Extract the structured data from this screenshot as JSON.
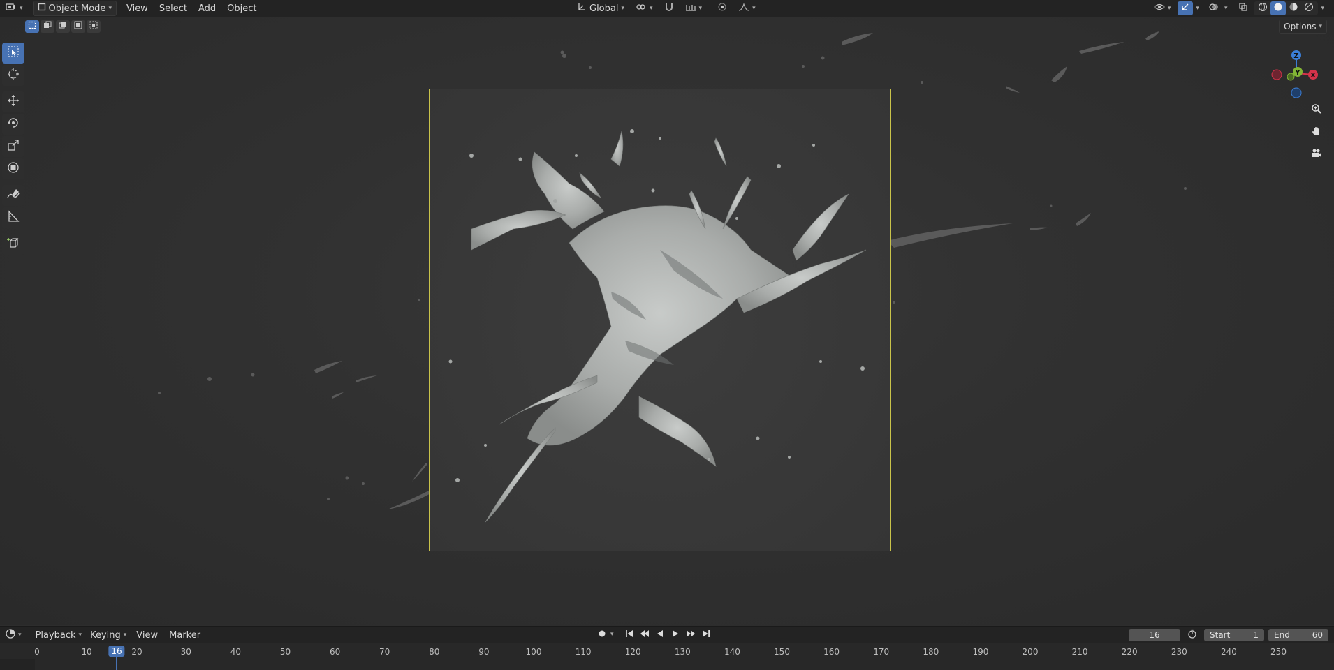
{
  "header": {
    "mode_label": "Object Mode",
    "menus": [
      "View",
      "Select",
      "Add",
      "Object"
    ],
    "transform_orientation": "Global"
  },
  "subbar": {
    "options_label": "Options"
  },
  "toolbar": {
    "tools": [
      "select-box",
      "cursor",
      "move",
      "rotate",
      "scale",
      "transform",
      "annotate",
      "measure",
      "add-cube"
    ],
    "active_tool": "select-box"
  },
  "gizmo": {
    "x_label": "X",
    "y_label": "Y",
    "z_label": "Z"
  },
  "timeline": {
    "menus": [
      "Playback",
      "Keying",
      "View",
      "Marker"
    ],
    "current_frame": "16",
    "start_label": "Start",
    "start_value": "1",
    "end_label": "End",
    "end_value": "60",
    "ruler_labels": [
      "0",
      "10",
      "20",
      "30",
      "40",
      "50",
      "60",
      "70",
      "80",
      "90",
      "100",
      "110",
      "120",
      "130",
      "140",
      "150",
      "160",
      "170",
      "180",
      "190",
      "200",
      "210",
      "220",
      "230",
      "240",
      "250"
    ]
  },
  "colors": {
    "accent": "#4772b3",
    "camera_frame": "#c9c34a",
    "axis_x": "#d6334a",
    "axis_y": "#82b535",
    "axis_z": "#3b7ed6"
  }
}
